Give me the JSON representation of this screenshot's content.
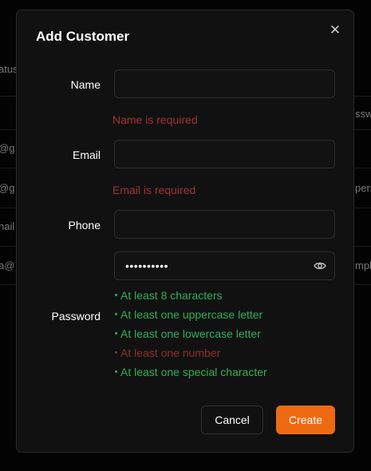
{
  "background": {
    "fragments": [
      "atus",
      "@g",
      "@g",
      "nail",
      "a@",
      "sswo",
      "pers",
      "mpl"
    ]
  },
  "modal": {
    "title": "Add Customer",
    "close_glyph": "✕",
    "fields": {
      "name_label": "Name",
      "name_value": "",
      "name_error": "Name is required",
      "email_label": "Email",
      "email_value": "",
      "email_error": "Email is required",
      "phone_label": "Phone",
      "phone_value": "",
      "password_label": "Password",
      "password_masked": "••••••••••"
    },
    "password_rules": [
      {
        "text": "At least 8 characters",
        "met": true
      },
      {
        "text": "At least one uppercase letter",
        "met": true
      },
      {
        "text": "At least one lowercase letter",
        "met": true
      },
      {
        "text": "At least one number",
        "met": false
      },
      {
        "text": "At least one special character",
        "met": true
      }
    ],
    "buttons": {
      "cancel": "Cancel",
      "create": "Create"
    }
  },
  "colors": {
    "accent": "#ee6a12",
    "error": "#a23232",
    "success": "#2fae5a"
  }
}
